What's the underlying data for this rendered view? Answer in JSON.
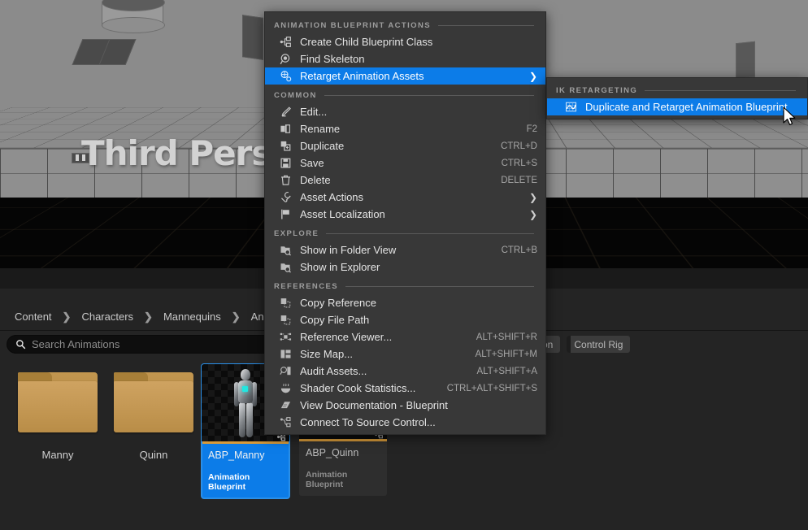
{
  "viewport": {
    "level_title": "Third Pers",
    "level_title_full": "Third Person"
  },
  "content_browser": {
    "breadcrumb": [
      "Content",
      "Characters",
      "Mannequins",
      "Animations"
    ],
    "breadcrumb_separator": "❯",
    "search": {
      "placeholder": "Search Animations",
      "value": "",
      "icon": "search-icon"
    },
    "filters": [
      {
        "label": "on",
        "icon": "filter-pill-partial"
      },
      {
        "label": "Control Rig",
        "icon": "filter-pill"
      }
    ],
    "folders": [
      {
        "label": "Manny",
        "icon": "folder-icon"
      },
      {
        "label": "Quinn",
        "icon": "folder-icon"
      }
    ],
    "assets": [
      {
        "name": "ABP_Manny",
        "type": "Animation Blueprint",
        "selected": true
      },
      {
        "name": "ABP_Quinn",
        "type": "Animation Blueprint",
        "selected": false
      }
    ]
  },
  "context_menu": {
    "sections": [
      {
        "label": "ANIMATION BLUEPRINT ACTIONS",
        "items": [
          {
            "label": "Create Child Blueprint Class",
            "shortcut": "",
            "icon": "child-class-icon",
            "submenu": false,
            "highlight": false
          },
          {
            "label": "Find Skeleton",
            "shortcut": "",
            "icon": "magnifier-icon",
            "submenu": false,
            "highlight": false
          },
          {
            "label": "Retarget Animation Assets",
            "shortcut": "",
            "icon": "retarget-icon",
            "submenu": true,
            "highlight": true
          }
        ]
      },
      {
        "label": "COMMON",
        "items": [
          {
            "label": "Edit...",
            "shortcut": "",
            "icon": "pencil-icon",
            "submenu": false,
            "highlight": false
          },
          {
            "label": "Rename",
            "shortcut": "F2",
            "icon": "rename-icon",
            "submenu": false,
            "highlight": false
          },
          {
            "label": "Duplicate",
            "shortcut": "CTRL+D",
            "icon": "duplicate-icon",
            "submenu": false,
            "highlight": false
          },
          {
            "label": "Save",
            "shortcut": "CTRL+S",
            "icon": "save-icon",
            "submenu": false,
            "highlight": false
          },
          {
            "label": "Delete",
            "shortcut": "DELETE",
            "icon": "trash-icon",
            "submenu": false,
            "highlight": false
          },
          {
            "label": "Asset Actions",
            "shortcut": "",
            "icon": "wrench-icon",
            "submenu": true,
            "highlight": false
          },
          {
            "label": "Asset Localization",
            "shortcut": "",
            "icon": "flag-icon",
            "submenu": true,
            "highlight": false
          }
        ]
      },
      {
        "label": "EXPLORE",
        "items": [
          {
            "label": "Show in Folder View",
            "shortcut": "CTRL+B",
            "icon": "folder-search-icon",
            "submenu": false,
            "highlight": false
          },
          {
            "label": "Show in Explorer",
            "shortcut": "",
            "icon": "folder-search-icon",
            "submenu": false,
            "highlight": false
          }
        ]
      },
      {
        "label": "REFERENCES",
        "items": [
          {
            "label": "Copy Reference",
            "shortcut": "",
            "icon": "copy-reference-icon",
            "submenu": false,
            "highlight": false
          },
          {
            "label": "Copy File Path",
            "shortcut": "",
            "icon": "copy-path-icon",
            "submenu": false,
            "highlight": false
          },
          {
            "label": "Reference Viewer...",
            "shortcut": "ALT+SHIFT+R",
            "icon": "reference-viewer-icon",
            "submenu": false,
            "highlight": false
          },
          {
            "label": "Size Map...",
            "shortcut": "ALT+SHIFT+M",
            "icon": "size-map-icon",
            "submenu": false,
            "highlight": false
          },
          {
            "label": "Audit Assets...",
            "shortcut": "ALT+SHIFT+A",
            "icon": "audit-icon",
            "submenu": false,
            "highlight": false
          },
          {
            "label": "Shader Cook Statistics...",
            "shortcut": "CTRL+ALT+SHIFT+S",
            "icon": "shader-cook-icon",
            "submenu": false,
            "highlight": false
          },
          {
            "label": "View Documentation - Blueprint",
            "shortcut": "",
            "icon": "documentation-icon",
            "submenu": false,
            "highlight": false
          },
          {
            "label": "Connect To Source Control...",
            "shortcut": "",
            "icon": "source-control-icon",
            "submenu": false,
            "highlight": false
          }
        ]
      }
    ]
  },
  "submenu": {
    "section_label": "IK RETARGETING",
    "items": [
      {
        "label": "Duplicate and Retarget Animation Blueprint",
        "shortcut": "",
        "icon": "retarget-curve-icon",
        "highlight": true
      }
    ]
  },
  "colors": {
    "highlight_blue": "#0c7ce8",
    "menu_background": "#383838",
    "panel_background": "#242424",
    "asset_accent": "#d79a3a",
    "folder_gold": "#c2964f",
    "core_cyan": "#23e6e0"
  }
}
